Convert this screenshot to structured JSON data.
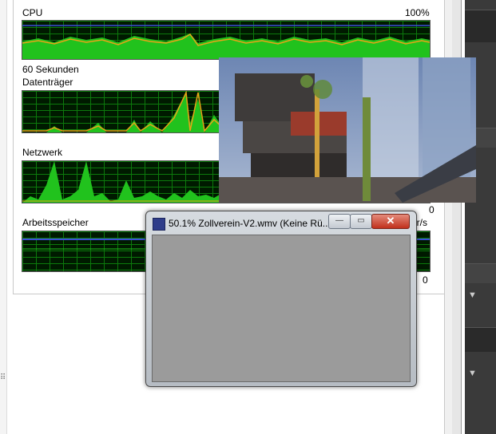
{
  "monitor": {
    "cpu_label": "CPU",
    "cpu_max": "100%",
    "time_label": "60 Sekunden",
    "disk_label": "Datenträger",
    "network_label": "Netzwerk",
    "memory_label": "Arbeitsspeicher",
    "memory_unit_suffix": "er/s",
    "memory_min": "0",
    "network_min": "0"
  },
  "media_window": {
    "title": "50.1% Zollverein-V2.wmv (Keine Rü...",
    "minimize_glyph": "—",
    "maximize_glyph": "▭",
    "close_glyph": "✕"
  },
  "icons": [
    "windows-media-player-icon",
    "grip-icon",
    "chevron-down-icon"
  ],
  "colors": {
    "graph_bg": "#001a00",
    "graph_grid": "#0c7a0c",
    "graph_fill": "#21c21d",
    "graph_line_orange": "#e8a317",
    "graph_line_blue": "#3b4fd6",
    "window_client": "#9b9b9b",
    "close_button": "#c1301c"
  }
}
